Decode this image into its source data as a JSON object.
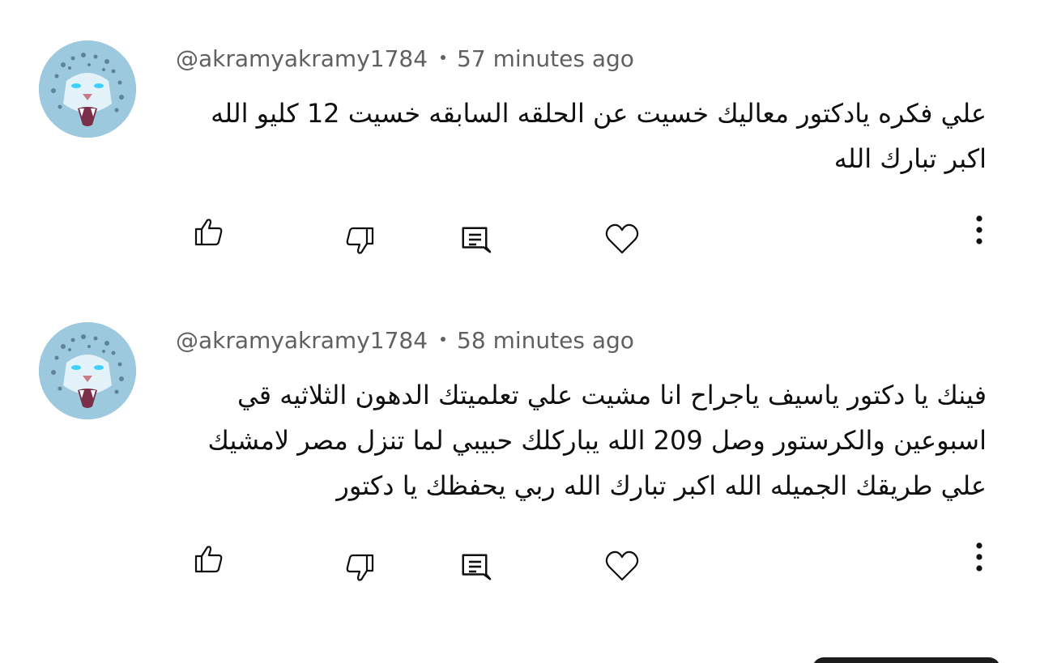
{
  "comments": [
    {
      "author": "@akramyakramy1784",
      "time": "57 minutes ago",
      "lines": [
        "علي فكره يادكتور معاليك خسيت عن الحلقه السابقه خسيت 12 كليو الله",
        "اكبر تبارك الله"
      ]
    },
    {
      "author": "@akramyakramy1784",
      "time": "58 minutes ago",
      "lines": [
        "فينك يا دكتور ياسيف ياجراح انا مشيت علي تعلميتك الدهون الثلاثيه قي",
        "اسبوعين والكرستور وصل 209 الله يباركلك  حبيبي لما تنزل مصر لامشيك",
        "علي طريقك الجميله الله اكبر تبارك الله ربي يحفظك يا دكتور"
      ]
    }
  ],
  "icons": {
    "like": "thumbs-up-icon",
    "dislike": "thumbs-down-icon",
    "reply": "reply-icon",
    "heart": "heart-icon",
    "more": "more-vertical-icon"
  },
  "colors": {
    "meta_text": "#606060",
    "body_text": "#0f0f0f",
    "icon_stroke": "#0f0f0f"
  }
}
